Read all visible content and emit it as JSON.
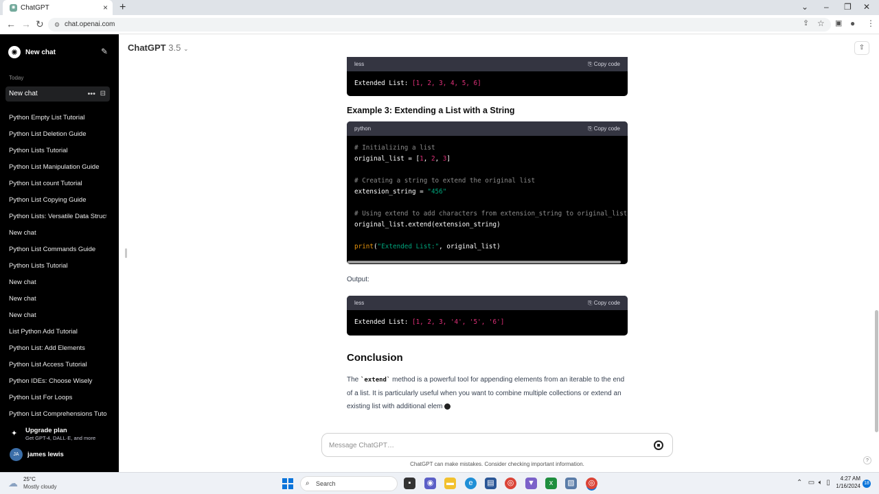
{
  "browser": {
    "tab_title": "ChatGPT",
    "url": "chat.openai.com"
  },
  "sidebar": {
    "new_chat_label": "New chat",
    "section_today": "Today",
    "active_chat": "New chat",
    "items": [
      "Python Empty List Tutorial",
      "Python List Deletion Guide",
      "Python Lists Tutorial",
      "Python List Manipulation Guide",
      "Python List count Tutorial",
      "Python List Copying Guide",
      "Python Lists: Versatile Data Struct",
      "New chat",
      "Python List Commands Guide",
      "Python Lists Tutorial",
      "New chat",
      "New chat",
      "New chat",
      "List Python Add Tutorial",
      "Python List: Add Elements",
      "Python List Access Tutorial",
      "Python IDEs: Choose Wisely",
      "Python List For Loops",
      "Python List Comprehensions Tuto"
    ],
    "upgrade_title": "Upgrade plan",
    "upgrade_subtitle": "Get GPT-4, DALL·E, and more",
    "user_initials": "JA",
    "user_name": "james lewis"
  },
  "header": {
    "model_name": "ChatGPT",
    "model_version": "3.5"
  },
  "content": {
    "block1": {
      "language": "less",
      "copy_label": "Copy code",
      "code_prefix": "Extended List: ",
      "code_value": "[1, 2, 3, 4, 5, 6]"
    },
    "example3_heading": "Example 3: Extending a List with a String",
    "block2": {
      "language": "python",
      "copy_label": "Copy code",
      "lines": {
        "c1": "# Initializing a list",
        "l1a": "original_list = [",
        "n1": "1",
        "n2": "2",
        "n3": "3",
        "c2": "# Creating a string to extend the original list",
        "l2a": "extension_string = ",
        "s1": "\"456\"",
        "c3": "# Using extend to add characters from extension_string to original_list",
        "l3": "original_list.extend(extension_string)",
        "fn": "print",
        "s2": "\"Extended List:\"",
        "l4b": ", original_list)"
      }
    },
    "output_label": "Output:",
    "block3": {
      "language": "less",
      "copy_label": "Copy code",
      "code_prefix": "Extended List: ",
      "code_value": "[1, 2, 3, '4', '5', '6']"
    },
    "conclusion_heading": "Conclusion",
    "conclusion": {
      "pre": "The ",
      "code": "`extend`",
      "post": " method is a powerful tool for appending elements from an iterable to the end of a list. It is particularly useful when you want to combine multiple collections or extend an existing list with additional elem"
    }
  },
  "composer": {
    "placeholder": "Message ChatGPT…",
    "disclaimer": "ChatGPT can make mistakes. Consider checking important information."
  },
  "taskbar": {
    "temperature": "25°C",
    "weather": "Mostly cloudy",
    "search_label": "Search",
    "time": "4:27 AM",
    "date": "1/16/2024",
    "notifications": "18"
  },
  "colors": {
    "sidebar_bg": "#000000",
    "code_header_bg": "#343541",
    "code_number": "#df3079",
    "code_string": "#00a67d",
    "code_comment": "#8c8c8c",
    "code_function": "#e9950c"
  }
}
